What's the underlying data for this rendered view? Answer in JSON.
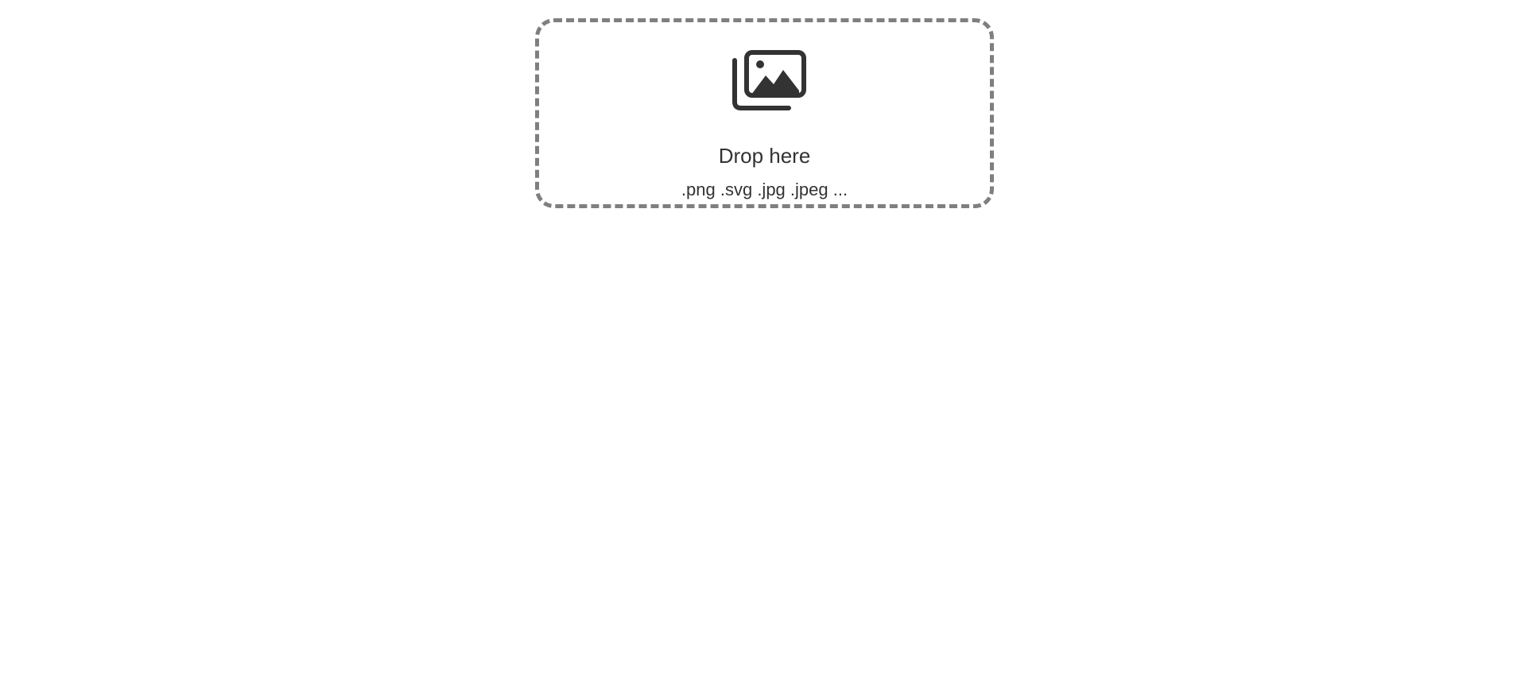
{
  "dropzone": {
    "title": "Drop here",
    "accepted_types": ".png .svg .jpg .jpeg ...",
    "icon": "images-icon",
    "border_color": "#7f7f7f",
    "text_color": "#333333"
  }
}
